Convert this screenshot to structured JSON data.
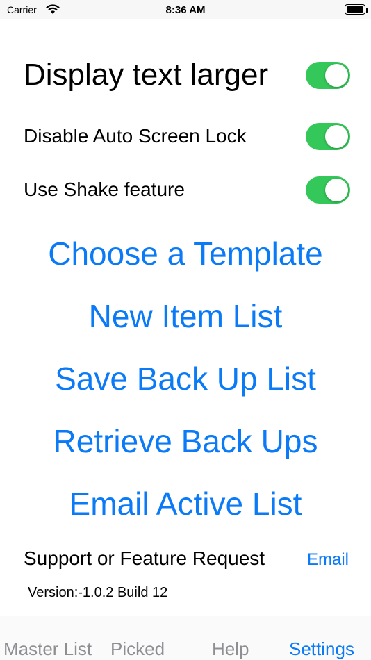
{
  "status_bar": {
    "carrier": "Carrier",
    "time": "8:36 AM"
  },
  "settings": {
    "toggles": [
      {
        "label": "Display text larger",
        "on": true
      },
      {
        "label": "Disable Auto Screen Lock",
        "on": true
      },
      {
        "label": "Use Shake feature",
        "on": true
      }
    ]
  },
  "actions": [
    "Choose a Template",
    "New Item List",
    "Save Back Up List",
    "Retrieve Back Ups",
    "Email Active List"
  ],
  "support": {
    "label": "Support or Feature Request",
    "link": "Email"
  },
  "version": "Version:-1.0.2 Build 12",
  "tabs": [
    {
      "label": "Master List",
      "active": false
    },
    {
      "label": "Picked",
      "active": false
    },
    {
      "label": "Help",
      "active": false
    },
    {
      "label": "Settings",
      "active": true
    }
  ],
  "colors": {
    "accent": "#0a7af7",
    "toggle_on": "#34c759",
    "tab_inactive": "#8e8e93"
  }
}
